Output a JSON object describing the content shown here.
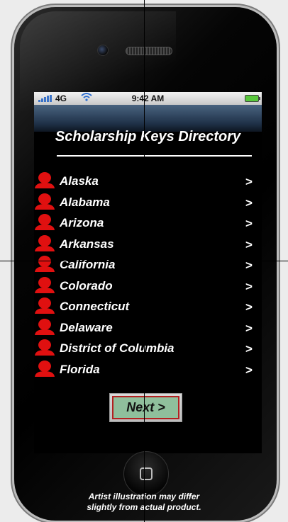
{
  "status": {
    "network": "4G",
    "time": "9:42 AM"
  },
  "header": {
    "title": "Scholarship Keys Directory"
  },
  "list": [
    {
      "label": "Alaska",
      "chevron": ">"
    },
    {
      "label": "Alabama",
      "chevron": ">"
    },
    {
      "label": "Arizona",
      "chevron": ">"
    },
    {
      "label": "Arkansas",
      "chevron": ">"
    },
    {
      "label": "California",
      "chevron": ">"
    },
    {
      "label": "Colorado",
      "chevron": ">"
    },
    {
      "label": "Connecticut",
      "chevron": ">"
    },
    {
      "label": "Delaware",
      "chevron": ">"
    },
    {
      "label": "District of Columbia",
      "chevron": ">"
    },
    {
      "label": "Florida",
      "chevron": ">"
    }
  ],
  "next_button": {
    "label": "Next  >"
  },
  "disclaimer": {
    "line1": "Artist illustration may differ",
    "line2": "slightly from  actual product."
  },
  "icons": {
    "person": "person-icon",
    "wifi": "wifi-icon",
    "battery": "battery-icon",
    "signal": "signal-icon",
    "home": "home-button-icon"
  },
  "colors": {
    "person_icon": "#e01010",
    "next_fill": "#8fbf9c",
    "next_border": "#b32020"
  }
}
